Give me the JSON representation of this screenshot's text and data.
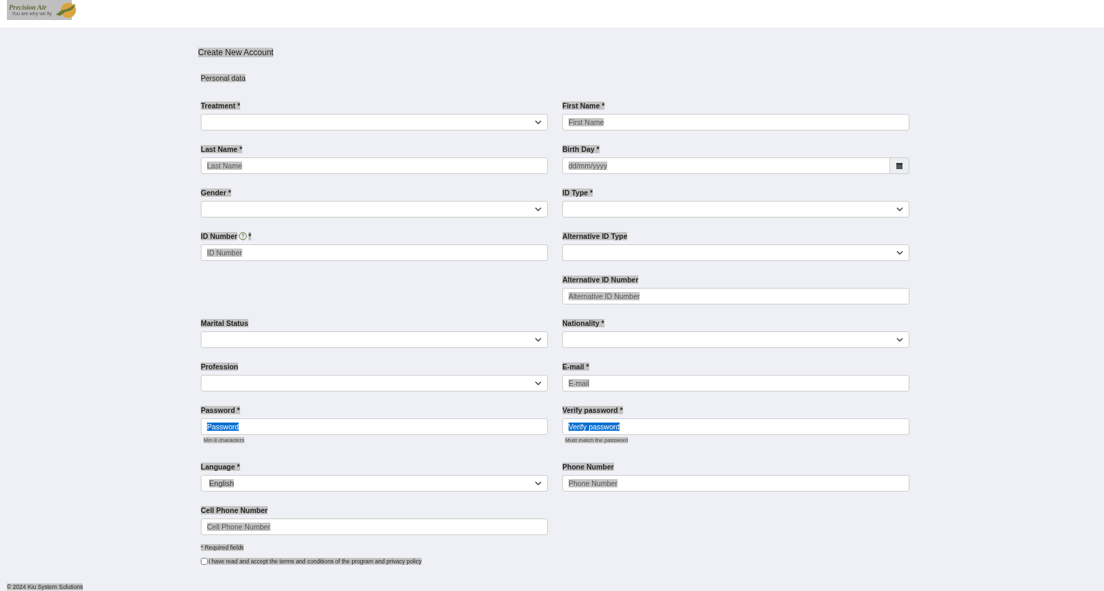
{
  "header": {
    "logo": {
      "name": "Precision Air",
      "tagline": "You are why we fly"
    }
  },
  "title": "Create New Account",
  "section": "Personal data",
  "rows": [
    {
      "left": {
        "kind": "select",
        "label": "Treatment *"
      },
      "right": {
        "kind": "text",
        "label": "First Name *",
        "placeholder": "First Name",
        "text_selected": false
      }
    },
    {
      "left": {
        "kind": "text",
        "label": "Last Name *",
        "placeholder": "Last Name",
        "text_selected": false
      },
      "right": {
        "kind": "date",
        "label": "Birth Day *",
        "placeholder": "dd/mm/yyyy"
      }
    },
    {
      "left": {
        "kind": "select",
        "label": "Gender *"
      },
      "right": {
        "kind": "select",
        "label": "ID Type *"
      }
    },
    {
      "left": {
        "kind": "text",
        "label": "ID Number",
        "help": true,
        "required_mark": "*",
        "placeholder": "ID Number",
        "text_selected": false
      },
      "right": {
        "kind": "select",
        "label": "Alternative ID Type"
      }
    },
    {
      "right": {
        "kind": "text",
        "label": "Alternative ID Number",
        "placeholder": "Alternative ID Number",
        "text_selected": false
      }
    },
    {
      "left": {
        "kind": "select",
        "label": "Marital Status"
      },
      "right": {
        "kind": "select",
        "label": "Nationality *"
      }
    },
    {
      "left": {
        "kind": "select",
        "label": "Profession"
      },
      "right": {
        "kind": "text",
        "label": "E-mail *",
        "placeholder": "E-mail",
        "text_selected": false
      }
    },
    {
      "left": {
        "kind": "text",
        "label": "Password *",
        "placeholder": "Password",
        "text_selected": true,
        "hint": "Min 8 characters"
      },
      "right": {
        "kind": "text",
        "label": "Verify password *",
        "placeholder": "Verify password",
        "text_selected": true,
        "hint": "Must match the password"
      }
    },
    {
      "left": {
        "kind": "select",
        "label": "Language *",
        "value": "English"
      },
      "right": {
        "kind": "text",
        "label": "Phone Number",
        "placeholder": "Phone Number",
        "text_selected": false
      }
    },
    {
      "left": {
        "kind": "text",
        "label": "Cell Phone Number",
        "placeholder": "Cell Phone Number",
        "text_selected": false
      }
    }
  ],
  "required_note": "* Required fields",
  "terms": {
    "label": "I have read and accept the terms and conditions of the program and privacy policy",
    "checked": false
  },
  "footer": "© 2024 Kiu System Solutions"
}
